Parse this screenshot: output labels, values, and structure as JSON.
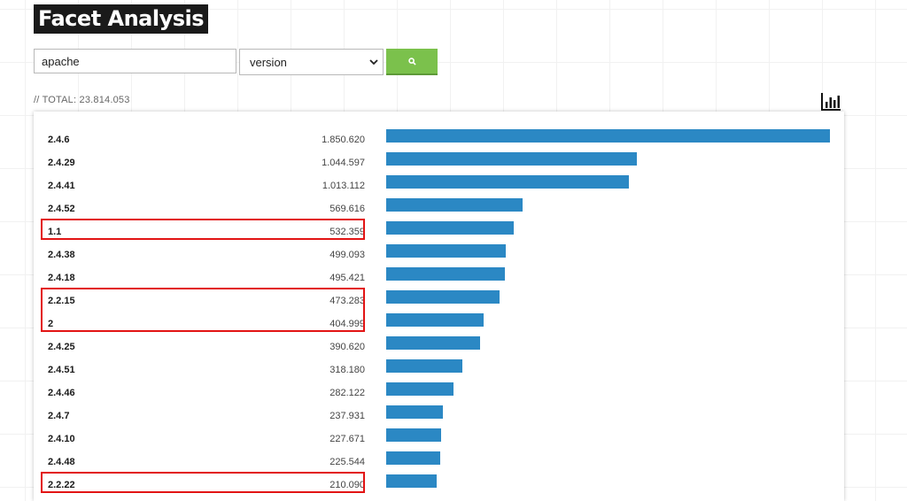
{
  "header": {
    "title": "Facet Analysis"
  },
  "search": {
    "query": "apache",
    "facet": "version"
  },
  "summary": {
    "total": "// TOTAL: 23.814.053"
  },
  "colors": {
    "bar": "#2b88c4",
    "search_button": "#7bc14c",
    "highlight": "#e21414"
  },
  "chart_data": {
    "type": "bar",
    "orientation": "horizontal",
    "categories": [
      "2.4.6",
      "2.4.29",
      "2.4.41",
      "2.4.52",
      "1.1",
      "2.4.38",
      "2.4.18",
      "2.2.15",
      "2",
      "2.4.25",
      "2.4.51",
      "2.4.46",
      "2.4.7",
      "2.4.10",
      "2.4.48",
      "2.2.22"
    ],
    "values": [
      1850620,
      1044597,
      1013112,
      569616,
      532359,
      499093,
      495421,
      473283,
      404999,
      390620,
      318180,
      282122,
      237931,
      227671,
      225544,
      210090
    ],
    "value_labels": [
      "1.850.620",
      "1.044.597",
      "1.013.112",
      "569.616",
      "532.359",
      "499.093",
      "495.421",
      "473.283",
      "404.999",
      "390.620",
      "318.180",
      "282.122",
      "237.931",
      "227.671",
      "225.544",
      "210.090"
    ],
    "highlighted": [
      "1.1",
      "2.2.15",
      "2",
      "2.2.22"
    ],
    "highlight_groups": [
      [
        "1.1"
      ],
      [
        "2.2.15",
        "2"
      ],
      [
        "2.2.22"
      ]
    ]
  }
}
